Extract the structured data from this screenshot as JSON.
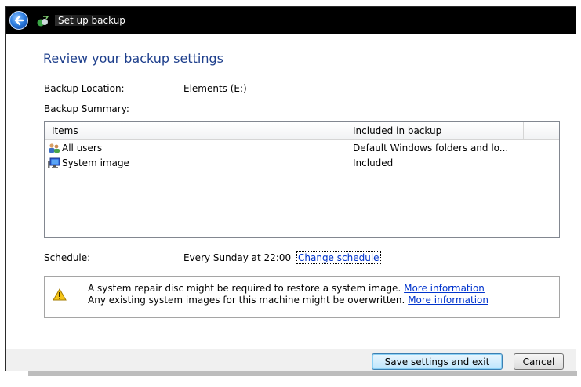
{
  "window": {
    "title": "Set up backup"
  },
  "page": {
    "heading": "Review your backup settings"
  },
  "location": {
    "label": "Backup Location:",
    "value": "Elements (E:)"
  },
  "summary": {
    "label": "Backup Summary:"
  },
  "list": {
    "columns": [
      "Items",
      "Included in backup"
    ],
    "rows": [
      {
        "item": "All users",
        "icon": "users-icon",
        "included": "Default Windows folders and lo..."
      },
      {
        "item": "System image",
        "icon": "system-image-icon",
        "included": "Included"
      }
    ]
  },
  "schedule": {
    "label": "Schedule:",
    "value": "Every Sunday at 22:00",
    "change_link": "Change schedule"
  },
  "warning": {
    "line1": "A system repair disc might be required to restore a system image.",
    "line1_link": "More information",
    "line2": "Any existing system images for this machine might be overwritten.",
    "line2_link": "More information"
  },
  "buttons": {
    "save": "Save settings and exit",
    "cancel": "Cancel"
  },
  "colors": {
    "heading": "#1e3f8c",
    "link": "#0033cc",
    "titlebar": "#000000"
  }
}
